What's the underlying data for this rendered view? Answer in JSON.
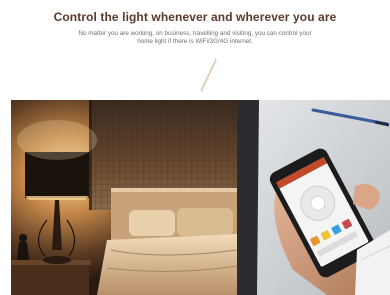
{
  "section": {
    "headline": "Control the light whenever and wherever you are",
    "subtext": "No matter you are working, on business, travelling and visiting, you can control your home light if there is WiFi/3G/4G internet."
  },
  "colors": {
    "headline": "#5a3a2a",
    "body_text": "#707070",
    "divider": "#b89a6a"
  },
  "images": {
    "left": "bedroom-lamp-photo",
    "right": "smartphone-app-photo"
  }
}
